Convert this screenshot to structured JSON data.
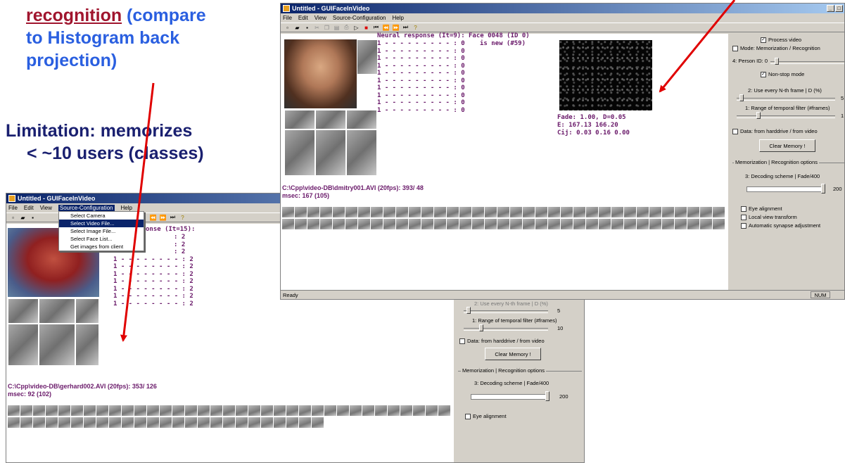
{
  "slide": {
    "recognition_word": "recognition",
    "recognition_rest_1": " (compare",
    "recognition_line_2": "to Histogram back",
    "recognition_line_3": "projection)",
    "limitation_line_1": "Limitation: memorizes",
    "limitation_line_2": "< ~10 users (classes)"
  },
  "colors": {
    "blue_text": "#2a5fe0",
    "dark_red_text": "#a0152e",
    "navy_text": "#1a2070",
    "arrow_red": "#e00000",
    "purple_text": "#6a1a6a"
  },
  "back_window": {
    "title": "Untitled - GUIFaceInVideo",
    "menu": [
      "File",
      "Edit",
      "View",
      "Source-Configuration",
      "Help"
    ],
    "dropdown_items": [
      "Select Camera",
      "Select Video File...",
      "Select Image File...",
      "Select Face List...",
      "Get images from client"
    ],
    "response_header": "onse (It=15):",
    "response_rows": [
      ": 2",
      ": 2",
      ": 2",
      "1 - - - - - - - - : 2",
      "1 - - - - - - - - : 2",
      "1 - - - - - - - - : 2",
      "1 - - - - - - - - : 2",
      "1 - - - - - - - - : 2",
      "1 - - - - - - - - : 2",
      "1 - - - - - - - - : 2"
    ],
    "file_info": "C:\\Cpp\\video-DB\\gerhard002.AVI (20fps): 353/ 126",
    "msec": "msec: 92 (102)",
    "panel": {
      "nth_frame_label": "2: Use every N-th frame | D (%)",
      "nth_frame_value": "5",
      "temporal_label": "1: Range of temporal filter (#frames)",
      "temporal_value": "10",
      "data_source": "Data: from harddrive / from video",
      "clear_memory": "Clear Memory !",
      "group_label": "Memorization | Recognition options",
      "decoding_label": "3: Decoding scheme | Fade/400",
      "decoding_value": "200",
      "eye_alignment": "Eye alignment"
    }
  },
  "front_window": {
    "title": "Untitled - GUIFaceInVideo",
    "menu": [
      "File",
      "Edit",
      "View",
      "Source-Configuration",
      "Help"
    ],
    "response_header": "Neural response (It=9):",
    "face_info_1": "Face 0048 (ID 0)",
    "face_info_2": "is new (#59)",
    "response_rows": [
      "1 - - - - - - - - - : 0",
      "1 - - - - - - - - - : 0",
      "1 - - - - - - - - - : 0",
      "1 - - - - - - - - - : 0",
      "1 - - - - - - - - - : 0",
      "1 - - - - - - - - - : 0",
      "1 - - - - - - - - - : 0",
      "1 - - - - - - - - - : 0",
      "1 - - - - - - - - - : 0",
      "1 - - - - - - - - - : 0"
    ],
    "fade": "Fade: 1.00, D=0.05",
    "e_vals": "E: 167.13 166.20",
    "cij": "Cij: 0.03 0.16 0.00",
    "file_info": "C:\\Cpp\\video-DB\\dmitry001.AVI (20fps): 393/ 48",
    "msec": "msec: 167 (105)",
    "status": "Ready",
    "status_num": "NUM",
    "panel": {
      "process_video": "Process video",
      "mode": "Mode: Memorization / Recognition",
      "person_id": "4: Person ID:  0",
      "non_stop": "Non-stop mode",
      "nth_frame_label": "2: Use every N-th frame | D (%)",
      "nth_frame_value": "5",
      "temporal_label": "1: Range of temporal filter (#frames)",
      "temporal_value": "1",
      "data_source": "Data: from harddrive / from video",
      "clear_memory": "Clear Memory !",
      "group_label": "Memorization | Recognition options",
      "decoding_label": "3: Decoding scheme | Fade/400",
      "decoding_value": "200",
      "eye_alignment": "Eye alignment",
      "local_view": "Local view transform",
      "synapse": "Automatic synapse adjustment"
    }
  }
}
